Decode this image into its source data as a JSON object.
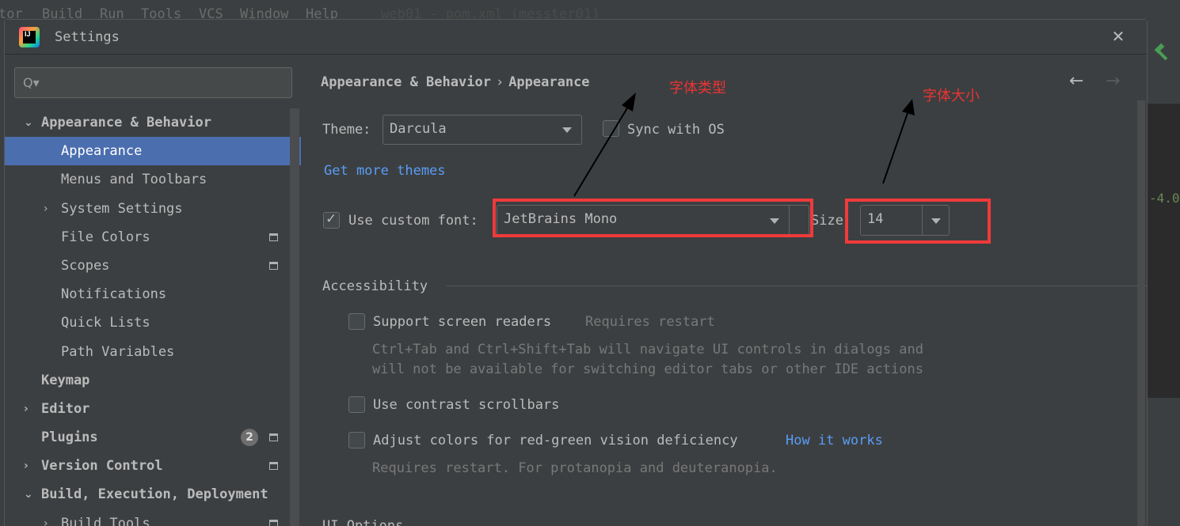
{
  "ide": {
    "menu": [
      "tor",
      "Build",
      "Run",
      "Tools",
      "VCS",
      "Window",
      "Help"
    ],
    "window_title": "web01 - pom.xml (messter01)",
    "code_fragment": "-4.0"
  },
  "dialog": {
    "logo_text": "IJ",
    "title": "Settings",
    "close_glyph": "✕"
  },
  "sidebar": {
    "search_placeholder": "",
    "search_icon": "Q▾",
    "items": [
      {
        "label": "Appearance & Behavior",
        "arrow": "⌄",
        "bold": true,
        "indent": 0
      },
      {
        "label": "Appearance",
        "arrow": "",
        "bold": false,
        "indent": 1,
        "selected": true
      },
      {
        "label": "Menus and Toolbars",
        "arrow": "",
        "bold": false,
        "indent": 1
      },
      {
        "label": "System Settings",
        "arrow": "›",
        "bold": false,
        "indent": 1
      },
      {
        "label": "File Colors",
        "arrow": "",
        "bold": false,
        "indent": 1,
        "project_icon": true
      },
      {
        "label": "Scopes",
        "arrow": "",
        "bold": false,
        "indent": 1,
        "project_icon": true
      },
      {
        "label": "Notifications",
        "arrow": "",
        "bold": false,
        "indent": 1
      },
      {
        "label": "Quick Lists",
        "arrow": "",
        "bold": false,
        "indent": 1
      },
      {
        "label": "Path Variables",
        "arrow": "",
        "bold": false,
        "indent": 1
      },
      {
        "label": "Keymap",
        "arrow": "",
        "bold": true,
        "indent": 0
      },
      {
        "label": "Editor",
        "arrow": "›",
        "bold": true,
        "indent": 0
      },
      {
        "label": "Plugins",
        "arrow": "",
        "bold": true,
        "indent": 0,
        "badge": "2",
        "project_icon": true
      },
      {
        "label": "Version Control",
        "arrow": "›",
        "bold": true,
        "indent": 0,
        "project_icon": true
      },
      {
        "label": "Build, Execution, Deployment",
        "arrow": "⌄",
        "bold": true,
        "indent": 0
      },
      {
        "label": "Build Tools",
        "arrow": "›",
        "bold": false,
        "indent": 1,
        "project_icon": true
      }
    ]
  },
  "content": {
    "breadcrumb_parent": "Appearance & Behavior",
    "breadcrumb_sep": "›",
    "breadcrumb_current": "Appearance",
    "nav_back": "←",
    "nav_forward": "→",
    "theme_label": "Theme:",
    "theme_value": "Darcula",
    "sync_os_label": "Sync with OS",
    "get_more_themes": "Get more themes",
    "custom_font_label": "Use custom font:",
    "font_value": "JetBrains Mono",
    "size_label": "Size",
    "size_value": "14",
    "accessibility_title": "Accessibility",
    "screen_readers_label": "Support screen readers",
    "requires_restart": "Requires restart",
    "screen_readers_hint_1": "Ctrl+Tab and Ctrl+Shift+Tab will navigate UI controls in dialogs and",
    "screen_readers_hint_2": "will not be available for switching editor tabs or other IDE actions",
    "contrast_scrollbars_label": "Use contrast scrollbars",
    "color_deficiency_label": "Adjust colors for red-green vision deficiency",
    "how_it_works": "How it works",
    "color_deficiency_hint": "Requires restart. For protanopia and deuteranopia.",
    "ui_options_title": "UI Options"
  },
  "annotations": {
    "font_type": "字体类型",
    "font_size": "字体大小"
  },
  "colors": {
    "selection": "#4b6eaf",
    "link": "#589df6",
    "annotation_red": "#f03a3a",
    "background": "#3c3f41"
  }
}
